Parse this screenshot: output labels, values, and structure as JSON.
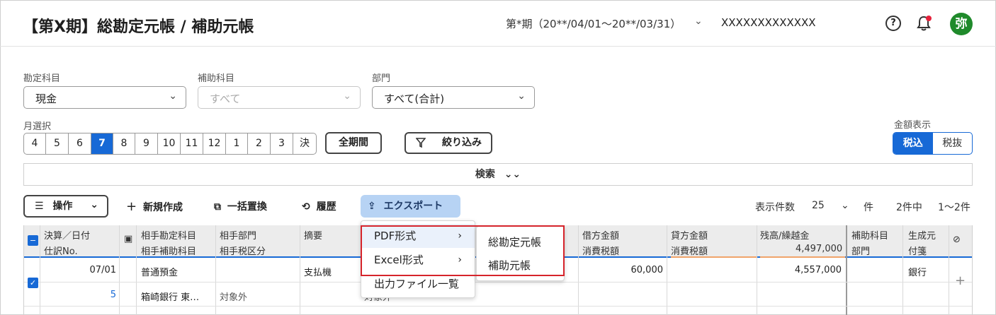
{
  "header": {
    "title": "【第X期】総勘定元帳 / 補助元帳",
    "period": "第*期（20**/04/01〜20**/03/31）",
    "company": "XXXXXXXXXXXXX",
    "avatar": "弥",
    "icons": [
      "help-icon",
      "bell-icon"
    ]
  },
  "filters": {
    "account_label": "勘定科目",
    "account_value": "現金",
    "sub_account_label": "補助科目",
    "sub_account_placeholder": "すべて",
    "department_label": "部門",
    "department_value": "すべて(合計)",
    "month_label": "月選択",
    "months": [
      "4",
      "5",
      "6",
      "7",
      "8",
      "9",
      "10",
      "11",
      "12",
      "1",
      "2",
      "3",
      "決"
    ],
    "active_month": "7",
    "all_period": "全期間",
    "narrow": "絞り込み",
    "amount_display_label": "金額表示",
    "tax_incl": "税込",
    "tax_excl": "税抜",
    "search": "検索"
  },
  "toolbar": {
    "operations": "操作",
    "new": "新規作成",
    "bulk_replace": "一括置換",
    "history": "履歴",
    "export": "エクスポート",
    "display_count_label": "表示件数",
    "display_count": "25",
    "unit": "件",
    "summary_a": "2件中",
    "summary_b": "1〜2件"
  },
  "table": {
    "headers": {
      "date_top": "決算／日付",
      "date_bottom": "仕訳No.",
      "acct_top": "相手勘定科目",
      "acct_bottom": "相手補助科目",
      "dept_top": "相手部門",
      "dept_bottom": "相手税区分",
      "memo": "摘要",
      "debit_top": "借方金額",
      "debit_bottom": "消費税額",
      "credit_top": "貸方金額",
      "credit_bottom": "消費税額",
      "balance_top": "残高/繰越金",
      "balance_bottom": "4,497,000",
      "sub_top": "補助科目",
      "sub_bottom": "部門",
      "origin_top": "生成元",
      "origin_bottom": "付箋"
    },
    "row": {
      "date": "07/01",
      "no": "5",
      "account": "普通預金",
      "sub_account": "箱崎銀行 東…",
      "tax": "対象外",
      "memo": "支払機",
      "memo_tax": "対象外",
      "debit": "60,000",
      "balance": "4,557,000",
      "origin": "銀行",
      "add": "+"
    }
  },
  "export_menu": {
    "items": [
      "PDF形式",
      "Excel形式",
      "出力ファイル一覧"
    ],
    "submenu": [
      "総勘定元帳",
      "補助元帳"
    ]
  },
  "colors": {
    "accent": "#1769d6",
    "avatar": "#1f8a2b",
    "highlight": "#d6242b"
  }
}
